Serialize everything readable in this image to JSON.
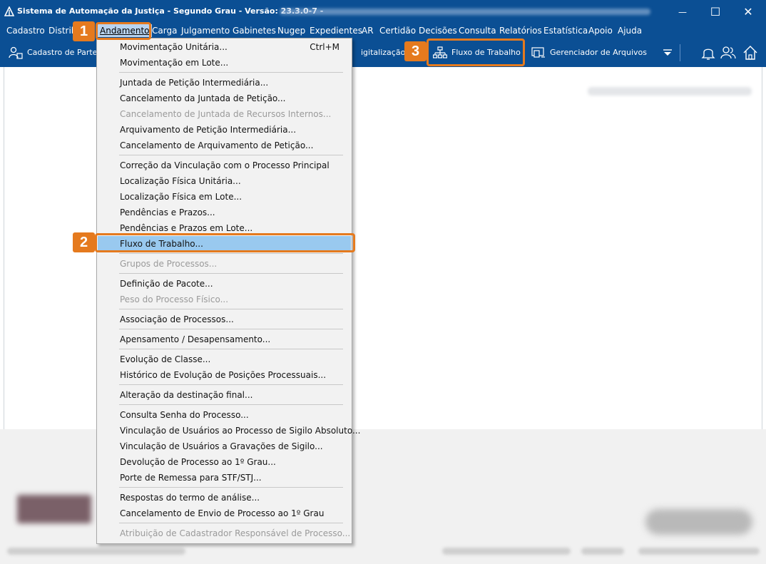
{
  "window": {
    "title": "Sistema de Automação da Justiça - Segundo Grau - Versão: 23.3.0-7 -",
    "minimize_glyph": "—",
    "maximize_glyph": "☐",
    "close_glyph": "✕"
  },
  "menubar": {
    "items": [
      "Cadastro",
      "Distrib",
      "Andamento",
      "Carga",
      "Julgamento",
      "Gabinetes",
      "Nugep",
      "Expedientes",
      "AR",
      "Certidão",
      "Decisões",
      "Consulta",
      "Relatórios",
      "Estatística",
      "Apoio",
      "Ajuda"
    ],
    "active": "Andamento"
  },
  "toolbar": {
    "cadastro_partes": "Cadastro de Partes",
    "digitalizacao": "igitalização de",
    "fluxo_trabalho": "Fluxo de Trabalho",
    "gerenciador_arquivos": "Gerenciador de Arquivos"
  },
  "dropdown": {
    "items": [
      {
        "label": "Movimentação Unitária...",
        "shortcut": "Ctrl+M"
      },
      {
        "label": "Movimentação em Lote..."
      },
      {
        "label": "Juntada de Petição Intermediária..."
      },
      {
        "label": "Cancelamento da Juntada de Petição..."
      },
      {
        "label": "Cancelamento de Juntada de Recursos Internos...",
        "disabled": true
      },
      {
        "label": "Arquivamento de Petição Intermediária..."
      },
      {
        "label": "Cancelamento de Arquivamento de Petição..."
      },
      {
        "label": "Correção da Vinculação com o Processo Principal"
      },
      {
        "label": "Localização Física Unitária..."
      },
      {
        "label": "Localização Física em Lote..."
      },
      {
        "label": "Pendências e Prazos..."
      },
      {
        "label": "Pendências e Prazos em Lote..."
      },
      {
        "label": "Fluxo de Trabalho...",
        "highlight": true
      },
      {
        "label": "Grupos de Processos...",
        "disabled": true
      },
      {
        "label": "Definição de Pacote..."
      },
      {
        "label": "Peso do Processo Físico...",
        "disabled": true
      },
      {
        "label": "Associação de Processos..."
      },
      {
        "label": "Apensamento / Desapensamento..."
      },
      {
        "label": "Evolução de Classe..."
      },
      {
        "label": "Histórico de Evolução de Posições Processuais..."
      },
      {
        "label": "Alteração da destinação final..."
      },
      {
        "label": "Consulta Senha do Processo..."
      },
      {
        "label": "Vinculação de Usuários ao Processo de Sigilo Absoluto..."
      },
      {
        "label": "Vinculação de Usuários a Gravações de Sigilo..."
      },
      {
        "label": "Devolução de Processo ao 1º Grau..."
      },
      {
        "label": "Porte de Remessa para STF/STJ..."
      },
      {
        "label": "Respostas do termo de análise..."
      },
      {
        "label": "Cancelamento de Envio de Processo ao 1º Grau"
      },
      {
        "label": "Atribuição de Cadastrador Responsável de Processo...",
        "disabled": true
      }
    ]
  },
  "annotations": {
    "step1": "1",
    "step2": "2",
    "step3": "3"
  },
  "colors": {
    "app_blue": "#0b4f94",
    "menu_highlight": "#99c9ef",
    "annotation_orange": "#e57a1e"
  }
}
